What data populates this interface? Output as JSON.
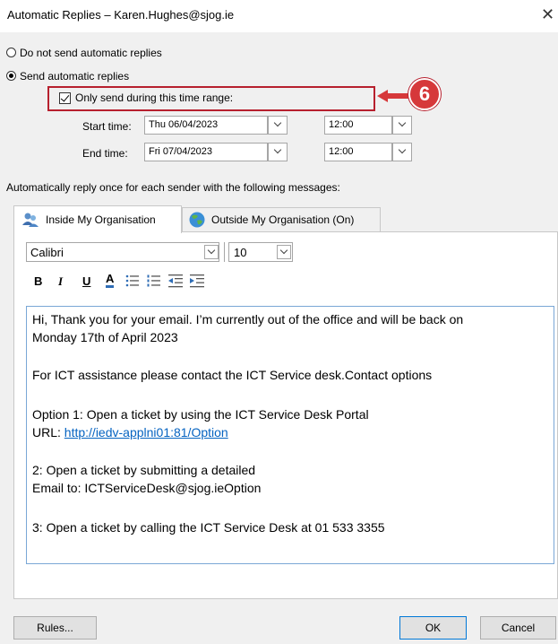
{
  "window": {
    "title": "Automatic Replies – Karen.Hughes@sjog.ie",
    "close_glyph": "✕"
  },
  "options": {
    "do_not_send": "Do not send automatic replies",
    "send": "Send automatic replies",
    "selected": "send",
    "only_during_range": "Only send during this time range:",
    "only_during_range_checked": true
  },
  "times": {
    "start_label": "Start time:",
    "start_date": "Thu 06/04/2023",
    "start_time": "12:00",
    "end_label": "End time:",
    "end_date": "Fri 07/04/2023",
    "end_time": "12:00"
  },
  "reply_once_text": "Automatically reply once for each sender with the following messages:",
  "tabs": [
    {
      "label": "Inside My Organisation",
      "icon": "people-icon",
      "active": true
    },
    {
      "label": "Outside My Organisation (On)",
      "icon": "globe-icon",
      "active": false
    }
  ],
  "editor": {
    "font": "Calibri",
    "size": "10",
    "format_buttons": [
      "B",
      "I",
      "U",
      "A"
    ]
  },
  "message": {
    "line1": "Hi, Thank you for your email. I’m currently out of the office and will be back on",
    "line2": "Monday 17th of April 2023",
    "line3": "For ICT assistance please contact the ICT Service desk.Contact options",
    "line4": "Option 1: Open a ticket by using the ICT Service Desk Portal",
    "url_label": "URL: ",
    "url": "http://iedv-applni01:81/Option",
    "line6": "2: Open a ticket by submitting a detailed",
    "line7": "Email to: ICTServiceDesk@sjog.ieOption",
    "line8": "3: Open a ticket by calling the ICT Service Desk at 01 533 3355"
  },
  "annotation": {
    "step": "6",
    "color": "#d6383a"
  },
  "buttons": {
    "rules": "Rules...",
    "ok": "OK",
    "cancel": "Cancel"
  }
}
